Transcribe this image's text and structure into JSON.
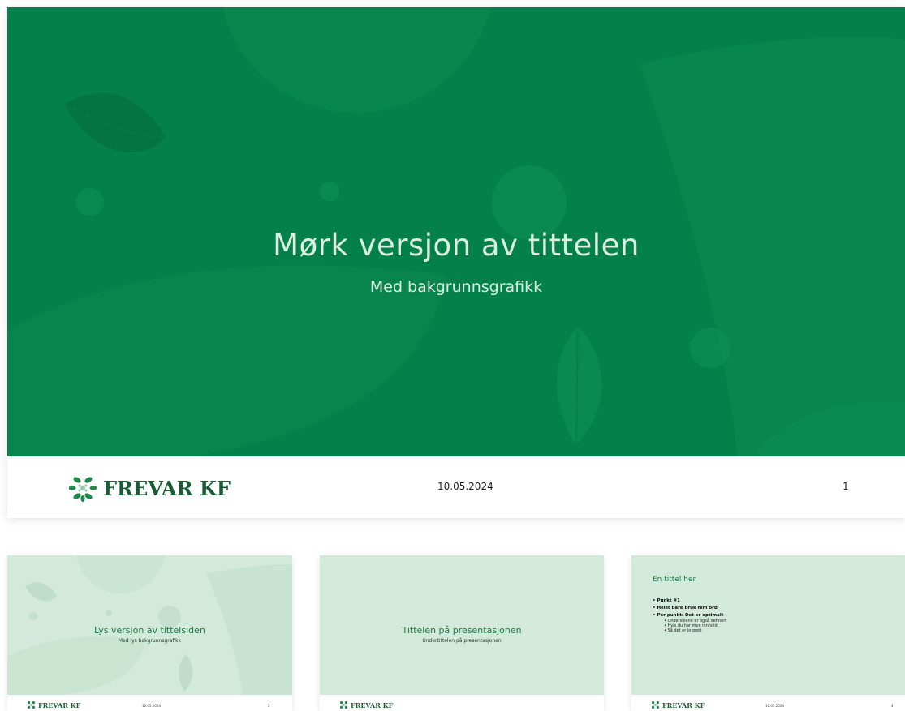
{
  "main_slide": {
    "title": "Mørk versjon av tittelen",
    "subtitle": "Med bakgrunnsgrafikk",
    "footer": {
      "logo_text": "FREVAR KF",
      "date": "10.05.2024",
      "page_number": "1"
    }
  },
  "thumbnails": [
    {
      "title": "Lys versjon av tittelsiden",
      "subtitle": "Med lys bakgrunnsgrafikk",
      "logo_text": "FREVAR KF",
      "date": "10.05.2024",
      "page_number": "2"
    },
    {
      "title": "Tittelen på presentasjonen",
      "subtitle": "Undertittelen på presentasjonen",
      "logo_text": "FREVAR KF"
    },
    {
      "title": "En tittel her",
      "bullets": [
        {
          "text": "Punkt #1"
        },
        {
          "text": "Helst bare bruk fem ord"
        },
        {
          "text": "Per punkt: Det er optimalt"
        }
      ],
      "sub_bullets": [
        {
          "text": "Underslilene er også definert"
        },
        {
          "text": "Hvis du har mye innhold"
        },
        {
          "text": "Så det er jo greit"
        }
      ],
      "logo_text": "FREVAR KF",
      "date": "10.05.2024",
      "page_number": "4"
    }
  ],
  "colors": {
    "dark_green": "#04814a",
    "light_green": "#d3e9db",
    "logo_green": "#1a5d35",
    "title_light": "#d9efe2"
  },
  "icons": {
    "logo": "frevar-leaf-cluster-icon"
  }
}
